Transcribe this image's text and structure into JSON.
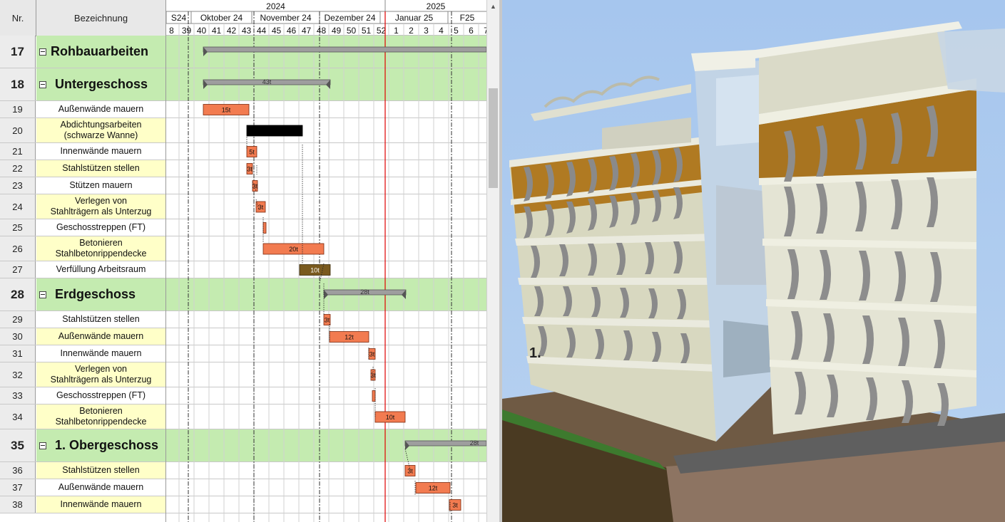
{
  "header": {
    "nr_label": "Nr.",
    "bez_label": "Bezeichnung"
  },
  "timeline": {
    "years": [
      {
        "label": "2024"
      },
      {
        "label": "2025"
      }
    ],
    "months": [
      "S24",
      "Oktober 24",
      "November 24",
      "Dezember 24",
      "Januar 25",
      "F25"
    ],
    "weeks": [
      "8",
      "39",
      "40",
      "41",
      "42",
      "43",
      "44",
      "45",
      "46",
      "47",
      "48",
      "49",
      "50",
      "51",
      "52",
      "1",
      "2",
      "3",
      "4",
      "5",
      "6",
      "7"
    ]
  },
  "tasks": [
    {
      "nr": "17",
      "label": "Rohbauarbeiten",
      "type": "summary"
    },
    {
      "nr": "18",
      "label": "Untergeschoss",
      "type": "summary"
    },
    {
      "nr": "19",
      "label": "Außenwände mauern",
      "type": "task"
    },
    {
      "nr": "20",
      "label": "Abdichtungsarbeiten\n(schwarze Wanne)",
      "type": "task"
    },
    {
      "nr": "21",
      "label": "Innenwände mauern",
      "type": "task"
    },
    {
      "nr": "22",
      "label": "Stahlstützen stellen",
      "type": "task"
    },
    {
      "nr": "23",
      "label": "Stützen mauern",
      "type": "task"
    },
    {
      "nr": "24",
      "label": "Verlegen von\nStahlträgern als Unterzug",
      "type": "task"
    },
    {
      "nr": "25",
      "label": "Geschosstreppen (FT)",
      "type": "task"
    },
    {
      "nr": "26",
      "label": "Betonieren\nStahlbetonrippendecke",
      "type": "task"
    },
    {
      "nr": "27",
      "label": "Verfüllung Arbeitsraum",
      "type": "task"
    },
    {
      "nr": "28",
      "label": "Erdgeschoss",
      "type": "summary"
    },
    {
      "nr": "29",
      "label": "Stahlstützen stellen",
      "type": "task"
    },
    {
      "nr": "30",
      "label": "Außenwände mauern",
      "type": "task"
    },
    {
      "nr": "31",
      "label": "Innenwände mauern",
      "type": "task"
    },
    {
      "nr": "32",
      "label": "Verlegen von\nStahlträgern als Unterzug",
      "type": "task"
    },
    {
      "nr": "33",
      "label": "Geschosstreppen (FT)",
      "type": "task"
    },
    {
      "nr": "34",
      "label": "Betonieren\nStahlbetonrippendecke",
      "type": "task"
    },
    {
      "nr": "35",
      "label": "1. Obergeschoss",
      "type": "summary"
    },
    {
      "nr": "36",
      "label": "Stahlstützen stellen",
      "type": "task"
    },
    {
      "nr": "37",
      "label": "Außenwände mauern",
      "type": "task"
    },
    {
      "nr": "38",
      "label": "Innenwände mauern",
      "type": "task"
    }
  ],
  "bars": [
    {
      "task": "17",
      "kind": "summary",
      "label": ""
    },
    {
      "task": "18",
      "kind": "summary",
      "label": "43t"
    },
    {
      "task": "19",
      "kind": "task",
      "label": "15t"
    },
    {
      "task": "20",
      "kind": "black",
      "label": ""
    },
    {
      "task": "21",
      "kind": "task",
      "label": "5t"
    },
    {
      "task": "22",
      "kind": "task",
      "label": "3t"
    },
    {
      "task": "23",
      "kind": "task",
      "label": "3t"
    },
    {
      "task": "24",
      "kind": "task",
      "label": "3t"
    },
    {
      "task": "25",
      "kind": "task",
      "label": ""
    },
    {
      "task": "26",
      "kind": "task",
      "label": "20t"
    },
    {
      "task": "27",
      "kind": "brown",
      "label": "10t"
    },
    {
      "task": "28",
      "kind": "summary",
      "label": "28t"
    },
    {
      "task": "29",
      "kind": "task",
      "label": "3t"
    },
    {
      "task": "30",
      "kind": "task",
      "label": "12t"
    },
    {
      "task": "31",
      "kind": "task",
      "label": "3t"
    },
    {
      "task": "32",
      "kind": "task",
      "label": "3t"
    },
    {
      "task": "33",
      "kind": "task",
      "label": ""
    },
    {
      "task": "34",
      "kind": "task",
      "label": "10t"
    },
    {
      "task": "35",
      "kind": "summary",
      "label": "28t"
    },
    {
      "task": "36",
      "kind": "task",
      "label": "3t"
    },
    {
      "task": "37",
      "kind": "task",
      "label": "12t"
    },
    {
      "task": "38",
      "kind": "task",
      "label": "3t"
    }
  ],
  "viewer": {
    "marker_label": "1."
  },
  "colors": {
    "summary_row": "#c4ebb0",
    "alt_row": "#ffffc8",
    "task_bar": "#f27b50",
    "task_bar_stroke": "#7a2a10",
    "black_bar": "#000000",
    "brown_bar": "#7a5a1e",
    "summary_bar": "#9e9e9e",
    "today_line": "#e00000",
    "sky": "#a9c8ec"
  }
}
